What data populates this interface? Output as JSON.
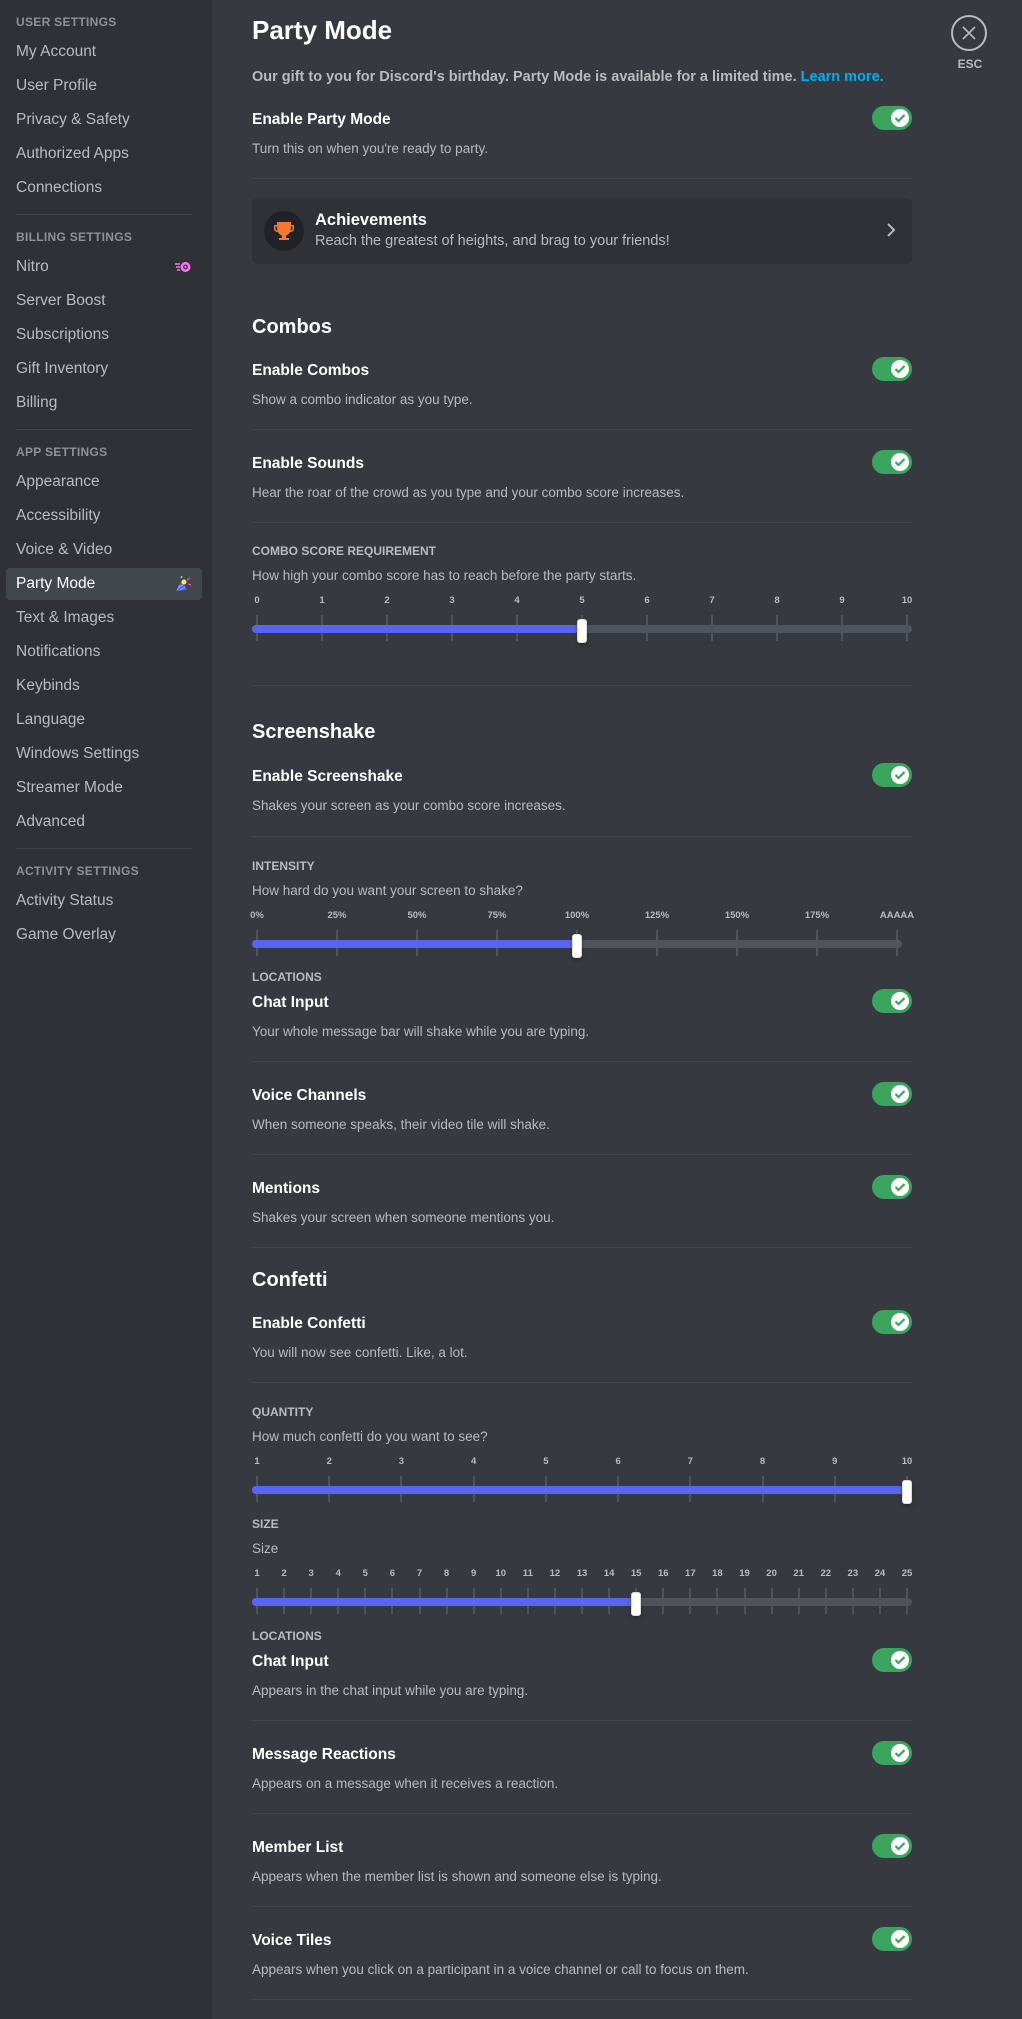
{
  "sidebar": {
    "groups": [
      {
        "header": "User Settings",
        "items": [
          "My Account",
          "User Profile",
          "Privacy & Safety",
          "Authorized Apps",
          "Connections"
        ]
      },
      {
        "header": "Billing Settings",
        "items": [
          "Nitro",
          "Server Boost",
          "Subscriptions",
          "Gift Inventory",
          "Billing"
        ]
      },
      {
        "header": "App Settings",
        "items": [
          "Appearance",
          "Accessibility",
          "Voice & Video",
          "Party Mode",
          "Text & Images",
          "Notifications",
          "Keybinds",
          "Language",
          "Windows Settings",
          "Streamer Mode",
          "Advanced"
        ]
      },
      {
        "header": "Activity Settings",
        "items": [
          "Activity Status",
          "Game Overlay"
        ]
      }
    ],
    "active_item": "Party Mode"
  },
  "close": {
    "label": "ESC"
  },
  "page": {
    "title": "Party Mode",
    "subtitle": "Our gift to you for Discord's birthday. Party Mode is available for a limited time.",
    "learn_more": "Learn more.",
    "enable": {
      "title": "Enable Party Mode",
      "desc": "Turn this on when you're ready to party.",
      "on": true
    },
    "achievements": {
      "title": "Achievements",
      "desc": "Reach the greatest of heights, and brag to your friends!"
    }
  },
  "combos": {
    "title": "Combos",
    "enable_combos": {
      "title": "Enable Combos",
      "desc": "Show a combo indicator as you type.",
      "on": true
    },
    "enable_sounds": {
      "title": "Enable Sounds",
      "desc": "Hear the roar of the crowd as you type and your combo score increases.",
      "on": true
    },
    "requirement": {
      "label": "Combo Score Requirement",
      "desc": "How high your combo score has to reach before the party starts.",
      "ticks": [
        "0",
        "1",
        "2",
        "3",
        "4",
        "5",
        "6",
        "7",
        "8",
        "9",
        "10"
      ],
      "value_index": 5
    }
  },
  "screenshake": {
    "title": "Screenshake",
    "enable": {
      "title": "Enable Screenshake",
      "desc": "Shakes your screen as your combo score increases.",
      "on": true
    },
    "intensity": {
      "label": "Intensity",
      "desc": "How hard do you want your screen to shake?",
      "ticks": [
        "0%",
        "25%",
        "50%",
        "75%",
        "100%",
        "125%",
        "150%",
        "175%",
        "AAAAA"
      ],
      "value_index": 4
    },
    "locations_label": "Locations",
    "locations": [
      {
        "title": "Chat Input",
        "desc": "Your whole message bar will shake while you are typing.",
        "on": true
      },
      {
        "title": "Voice Channels",
        "desc": "When someone speaks, their video tile will shake.",
        "on": true
      },
      {
        "title": "Mentions",
        "desc": "Shakes your screen when someone mentions you.",
        "on": true
      }
    ]
  },
  "confetti": {
    "title": "Confetti",
    "enable": {
      "title": "Enable Confetti",
      "desc": "You will now see confetti. Like, a lot.",
      "on": true
    },
    "quantity": {
      "label": "Quantity",
      "desc": "How much confetti do you want to see?",
      "ticks": [
        "1",
        "2",
        "3",
        "4",
        "5",
        "6",
        "7",
        "8",
        "9",
        "10"
      ],
      "value_index": 9
    },
    "size": {
      "label": "Size",
      "desc": "Size",
      "ticks": [
        "1",
        "2",
        "3",
        "4",
        "5",
        "6",
        "7",
        "8",
        "9",
        "10",
        "11",
        "12",
        "13",
        "14",
        "15",
        "16",
        "17",
        "18",
        "19",
        "20",
        "21",
        "22",
        "23",
        "24",
        "25"
      ],
      "value_index": 14
    },
    "locations_label": "Locations",
    "locations": [
      {
        "title": "Chat Input",
        "desc": "Appears in the chat input while you are typing.",
        "on": true
      },
      {
        "title": "Message Reactions",
        "desc": "Appears on a message when it receives a reaction.",
        "on": true
      },
      {
        "title": "Member List",
        "desc": "Appears when the member list is shown and someone else is typing.",
        "on": true
      },
      {
        "title": "Voice Tiles",
        "desc": "Appears when you click on a participant in a voice channel or call to focus on them.",
        "on": true
      }
    ]
  },
  "colors": {
    "accent": "#5865f2",
    "toggle_on": "#3ba55d",
    "link": "#00aff4",
    "trophy": "#f57731",
    "nitro": "#ff73fa"
  }
}
